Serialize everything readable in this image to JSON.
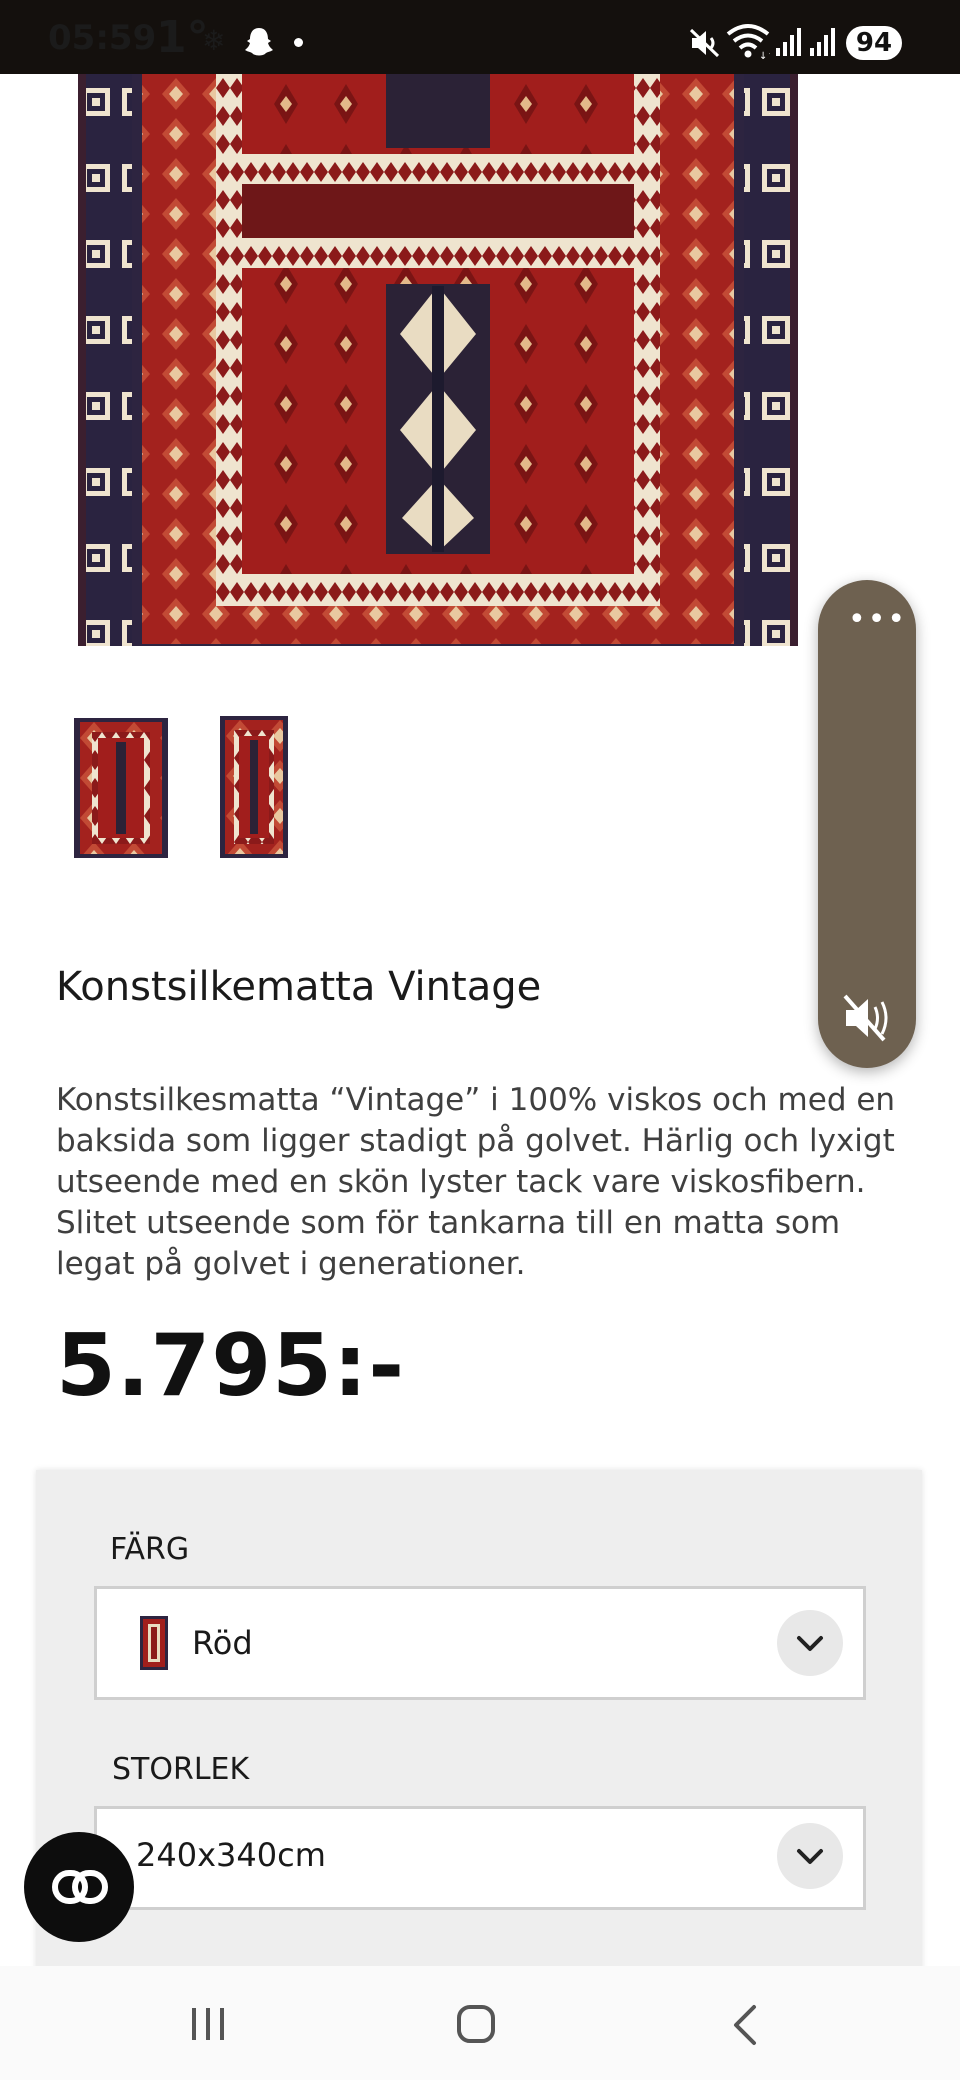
{
  "status_bar": {
    "time": "05:59",
    "temperature": "1°",
    "battery": "94"
  },
  "product": {
    "title": "Konstsilkematta Vintage",
    "description": "Konstsilkesmatta “Vintage” i 100% viskos och med en baksida som ligger stadigt på golvet. Härlig och lyxigt utseende med en skön lyster tack vare viskosfibern. Slitet utseende som för tankarna till en matta som legat på golvet i generationer.",
    "price": "5.795:-"
  },
  "options": {
    "color_label": "FÄRG",
    "color_value": "Röd",
    "size_label": "STORLEK",
    "size_value": "240x340cm"
  },
  "colors": {
    "rug_red": "#9c1f1c",
    "rug_navy": "#2a2340",
    "rug_cream": "#efe4cf",
    "float_panel": "#6e6150",
    "card_bg": "#eeeeee"
  },
  "icons": {
    "status": [
      "snowflake-icon",
      "snapchat-ghost-icon",
      "mute-icon",
      "wifi-icon",
      "signal-icon",
      "signal-icon"
    ],
    "float_panel": [
      "more-dots-icon",
      "volume-mute-icon"
    ],
    "select": "chevron-down-icon",
    "chat": "chat-link-icon",
    "nav": [
      "recents-icon",
      "home-icon",
      "back-icon"
    ]
  }
}
